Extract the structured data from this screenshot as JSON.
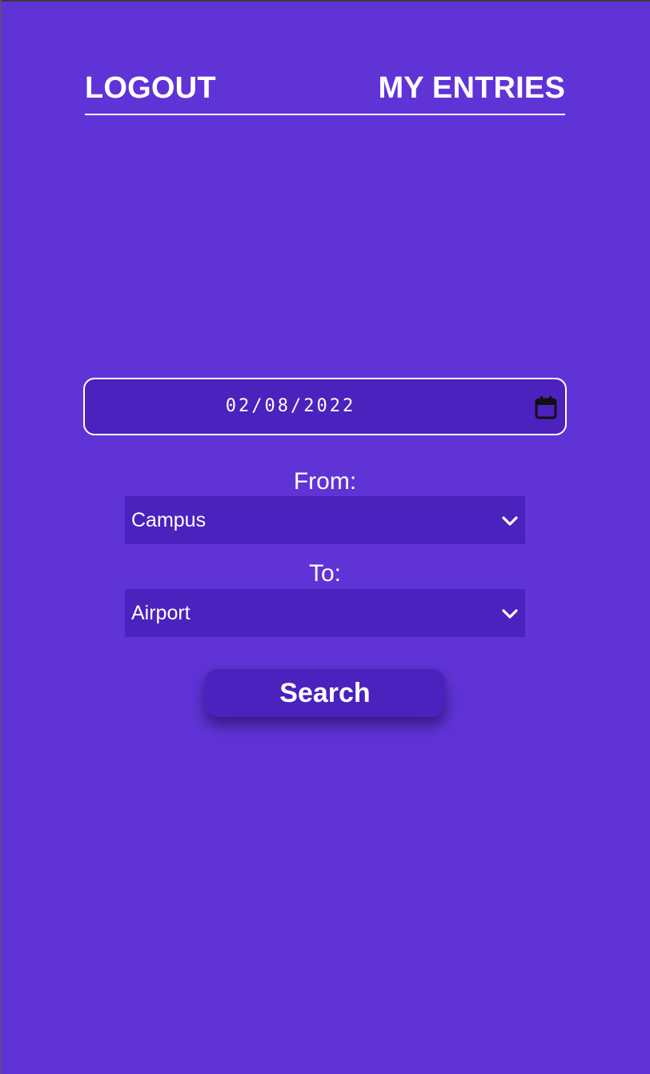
{
  "nav": {
    "logout_label": "LOGOUT",
    "entries_label": "MY ENTRIES"
  },
  "date": {
    "value": "02/08/2022",
    "icon": "calendar-icon"
  },
  "from": {
    "label": "From:",
    "selected": "Campus",
    "icon": "chevron-down-icon"
  },
  "to": {
    "label": "To:",
    "selected": "Airport",
    "icon": "chevron-down-icon"
  },
  "search": {
    "label": "Search"
  },
  "colors": {
    "background": "#6033d6",
    "field_background": "#4b22bd",
    "text": "#ffffff"
  }
}
